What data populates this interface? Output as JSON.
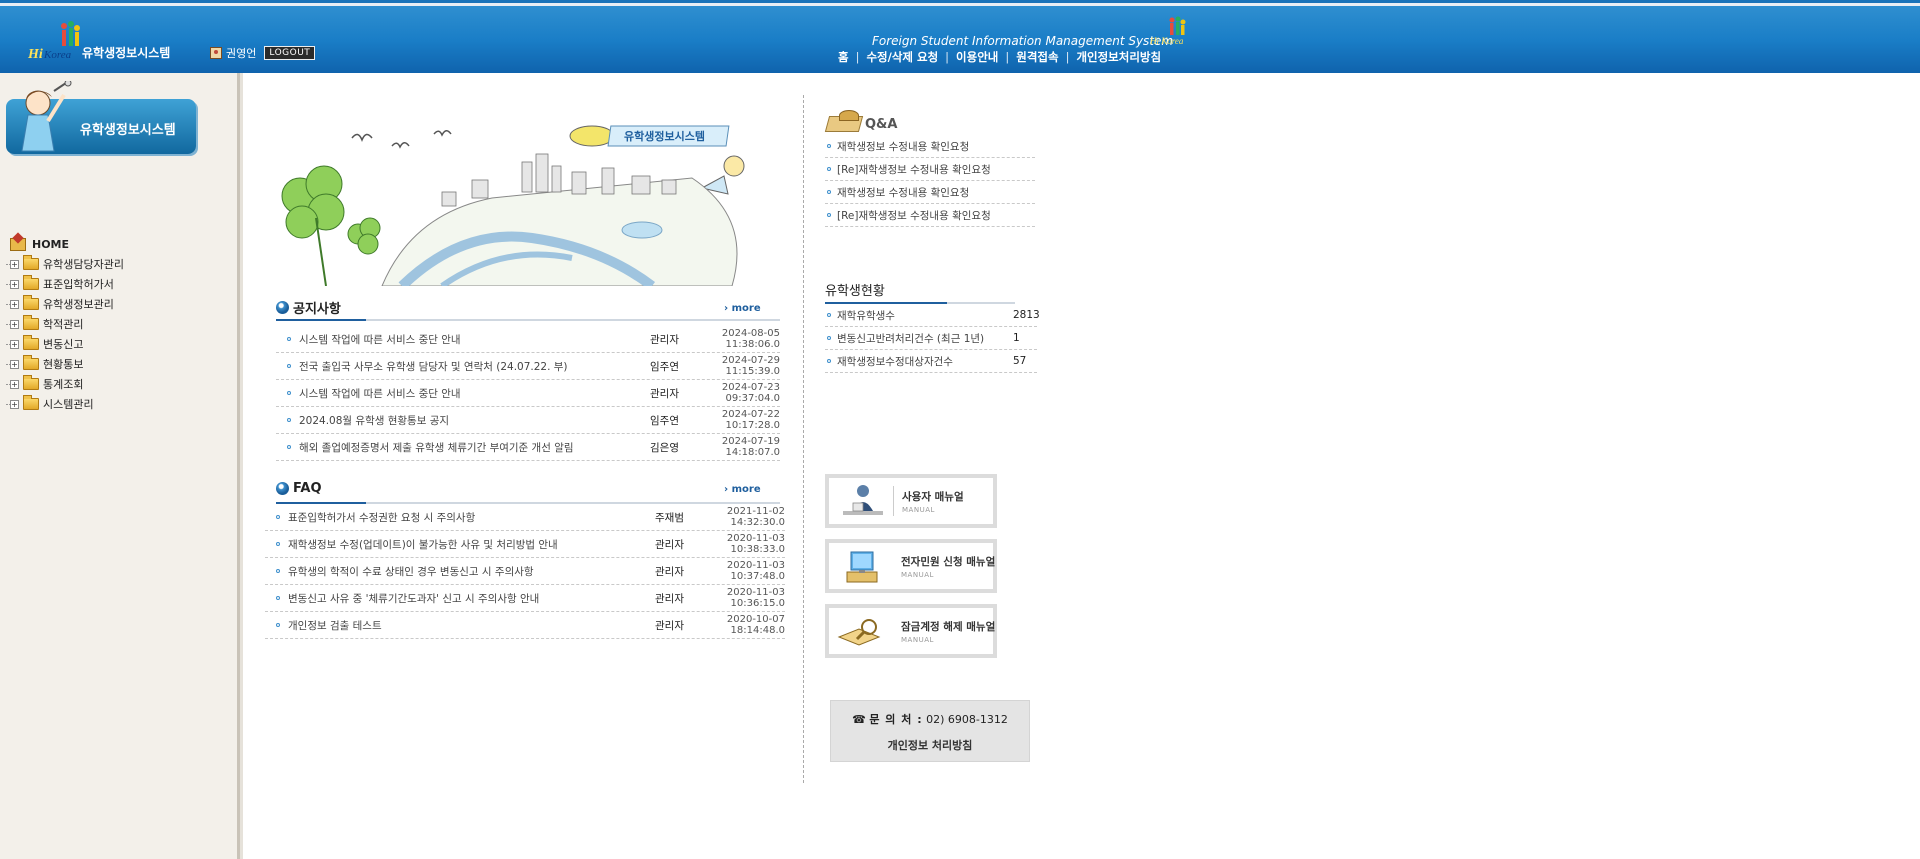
{
  "header": {
    "logo_title": "유학생정보시스템",
    "user_name": "권영언",
    "logout_label": "LOGOUT",
    "system_english_title": "Foreign Student Information Management System",
    "nav": [
      "홈",
      "수정/삭제 요청",
      "이용안내",
      "원격접속",
      "개인정보처리방침"
    ]
  },
  "sidebar": {
    "banner_label": "유학생정보시스템",
    "home_label": "HOME",
    "items": [
      "유학생담당자관리",
      "표준입학허가서",
      "유학생정보관리",
      "학적관리",
      "변동신고",
      "현황통보",
      "통계조회",
      "시스템관리"
    ]
  },
  "illustration": {
    "banner_text": "유학생정보시스템"
  },
  "notice": {
    "title": "공지사항",
    "more": "more",
    "rows": [
      {
        "title": "시스템 작업에 따른 서비스 중단 안내",
        "author": "관리자",
        "date": "2024-08-05",
        "time": "11:38:06.0"
      },
      {
        "title": "전국 출입국 사무소 유학생 담당자 및 연락처 (24.07.22. 부)",
        "author": "임주연",
        "date": "2024-07-29",
        "time": "11:15:39.0"
      },
      {
        "title": "시스템 작업에 따른 서비스 중단 안내",
        "author": "관리자",
        "date": "2024-07-23",
        "time": "09:37:04.0"
      },
      {
        "title": "2024.08월 유학생 현황통보 공지",
        "author": "임주연",
        "date": "2024-07-22",
        "time": "10:17:28.0"
      },
      {
        "title": "해외 졸업예정증명서 제출 유학생 체류기간 부여기준 개선 알림",
        "author": "김은영",
        "date": "2024-07-19",
        "time": "14:18:07.0"
      }
    ]
  },
  "faq": {
    "title": "FAQ",
    "more": "more",
    "rows": [
      {
        "title": "표준입학허가서 수정권한 요청 시 주의사항",
        "author": "주재범",
        "date": "2021-11-02",
        "time": "14:32:30.0"
      },
      {
        "title": "재학생정보 수정(업데이트)이 불가능한 사유 및 처리방법 안내",
        "author": "관리자",
        "date": "2020-11-03",
        "time": "10:38:33.0"
      },
      {
        "title": "유학생의 학적이 수료 상태인 경우 변동신고 시 주의사항",
        "author": "관리자",
        "date": "2020-11-03",
        "time": "10:37:48.0"
      },
      {
        "title": "변동신고 사유 중 '체류기간도과자' 신고 시 주의사항 안내",
        "author": "관리자",
        "date": "2020-11-03",
        "time": "10:36:15.0"
      },
      {
        "title": "개인정보 검출 테스트",
        "author": "관리자",
        "date": "2020-10-07",
        "time": "18:14:48.0"
      }
    ]
  },
  "qa": {
    "title": "Q&A",
    "items": [
      "재학생정보 수정내용 확인요청",
      "[Re]재학생정보 수정내용 확인요청",
      "재학생정보 수정내용 확인요청",
      "[Re]재학생정보 수정내용 확인요청"
    ]
  },
  "stats": {
    "title": "유학생현황",
    "rows": [
      {
        "label": "재학유학생수",
        "value": "2813"
      },
      {
        "label": "변동신고반려처리건수 (최근 1년)",
        "value": "1"
      },
      {
        "label": "재학생정보수정대상자건수",
        "value": "57"
      }
    ]
  },
  "manuals": [
    {
      "title": "사용자 매뉴얼",
      "sub": "MANUAL"
    },
    {
      "title": "전자민원 신청 매뉴얼",
      "sub": "MANUAL"
    },
    {
      "title": "잠금계정 해제 매뉴얼",
      "sub": "MANUAL"
    }
  ],
  "contact": {
    "label": "문 의 처 :",
    "phone": "02) 6908-1312",
    "privacy": "개인정보 처리방침"
  },
  "colors": {
    "header_blue": "#1a7ec7",
    "accent_blue": "#1f5f9e",
    "sidebar_bg": "#f3f0ea"
  }
}
